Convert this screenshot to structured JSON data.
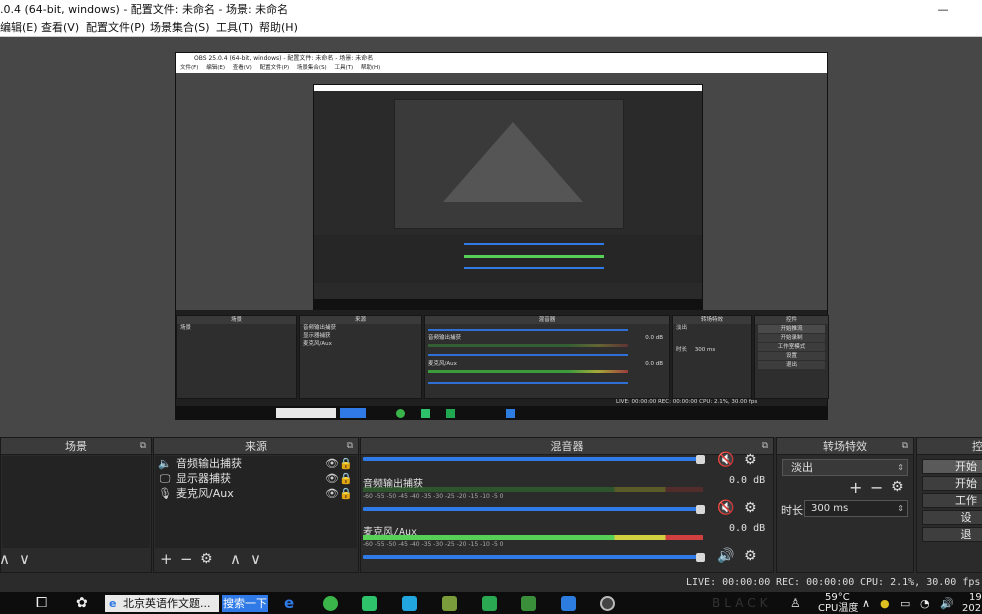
{
  "window": {
    "title": ".0.4 (64-bit, windows) - 配置文件: 未命名 - 场景: 未命名",
    "minimize": "—"
  },
  "menu": [
    "编辑(E)",
    "查看(V)",
    "配置文件(P)",
    "场景集合(S)",
    "工具(T)",
    "帮助(H)"
  ],
  "nested": {
    "title": "OBS 25.0.4 (64-bit, windows) - 配置文件: 未命名 - 场景: 未命名",
    "menu": [
      "文件(F)",
      "编辑(E)",
      "查看(V)",
      "配置文件(P)",
      "场景集合(S)",
      "工具(T)",
      "帮助(H)"
    ],
    "panels": {
      "scenes": "场景",
      "sources": "来源",
      "mixer": "混音器",
      "transitions": "转场特效",
      "controls": "控件"
    },
    "scene_item": "场景",
    "sources": [
      "音频输出捕获",
      "显示器捕获",
      "麦克风/Aux"
    ],
    "mixer_tracks": [
      "音频输出捕获",
      "麦克风/Aux"
    ],
    "db": "0.0 dB",
    "transition": "淡出",
    "duration_label": "时长",
    "duration": "300 ms",
    "controls": [
      "开始推流",
      "开始录制",
      "工作室模式",
      "设置",
      "退出"
    ],
    "status": "LIVE: 00:00:00   REC: 00:00:00   CPU: 2.1%, 30.00 fps"
  },
  "docks": {
    "scenes": {
      "title": "场景"
    },
    "sources": {
      "title": "来源",
      "items": [
        {
          "label": "音频输出捕获",
          "icon": "speaker-icon"
        },
        {
          "label": "显示器捕获",
          "icon": "monitor-icon"
        },
        {
          "label": "麦克风/Aux",
          "icon": "microphone-icon"
        }
      ]
    },
    "mixer": {
      "title": "混音器",
      "tracks": [
        {
          "name": "音频输出捕获",
          "db": "0.0 dB",
          "volume": 0.99
        },
        {
          "name": "麦克风/Aux",
          "db": "0.0 dB",
          "volume": 0.99
        }
      ],
      "scale": "-60  -55  -50  -45  -40  -35  -30  -25  -20  -15  -10  -5  0"
    },
    "transitions": {
      "title": "转场特效",
      "selected": "淡出",
      "duration_label": "时长",
      "duration": "300 ms"
    },
    "controls": {
      "title": "控",
      "buttons": [
        "开始",
        "开始",
        "工作",
        "设",
        "退"
      ]
    }
  },
  "status": {
    "live": "LIVE: 00:00:00",
    "rec": "REC: 00:00:00",
    "cpu": "CPU: 2.1%, 30.00 fps"
  },
  "taskbar": {
    "browser_tab": "北京英语作文题...",
    "search_button": "搜索一下",
    "temperature": "59°C",
    "cpu_temp": "CPU温度",
    "time": "19",
    "date": "202",
    "watermark": "BLACK"
  },
  "colors": {
    "accent_blue": "#2f7ae6",
    "mute_red": "#e03030",
    "meter_green": "#56d056"
  }
}
